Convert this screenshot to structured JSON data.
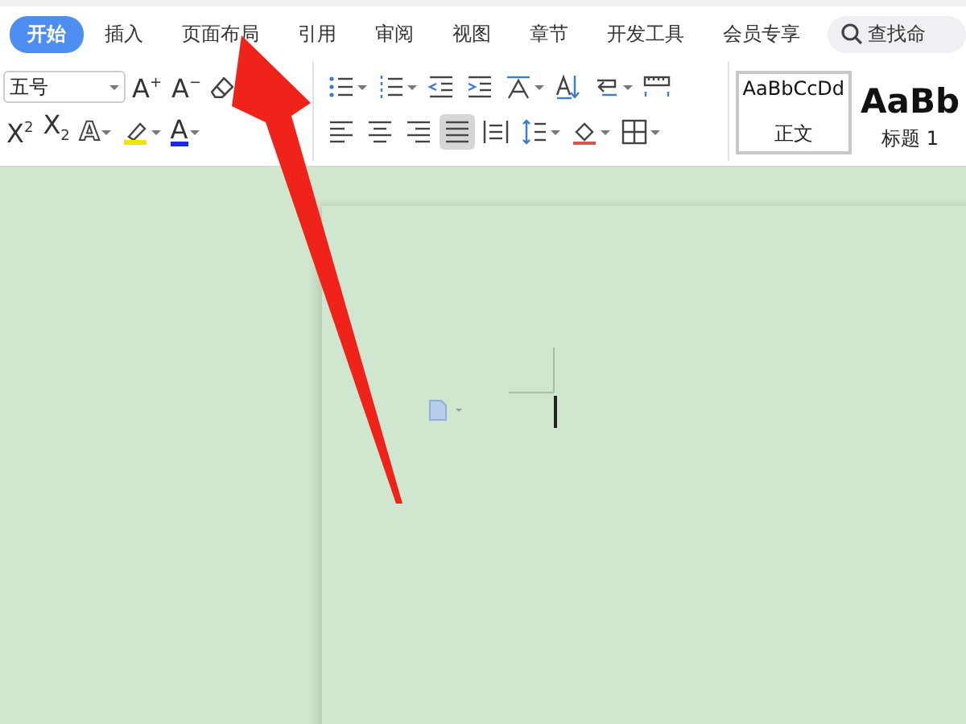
{
  "tabs": [
    {
      "label": "开始",
      "selected": true
    },
    {
      "label": "插入",
      "selected": false
    },
    {
      "label": "页面布局",
      "selected": false
    },
    {
      "label": "引用",
      "selected": false
    },
    {
      "label": "审阅",
      "selected": false
    },
    {
      "label": "视图",
      "selected": false
    },
    {
      "label": "章节",
      "selected": false
    },
    {
      "label": "开发工具",
      "selected": false
    },
    {
      "label": "会员专享",
      "selected": false
    }
  ],
  "search": {
    "placeholder": "查找命"
  },
  "font_size": {
    "value": "五号"
  },
  "font_row_1": [
    {
      "kind": "glyph",
      "text": "A$^{+}$",
      "dropdown": false
    },
    {
      "kind": "glyph",
      "text": "A$^{−}$",
      "dropdown": false
    },
    {
      "kind": "eraser",
      "dropdown": false
    }
  ],
  "font_row_2": [
    {
      "kind": "glyph",
      "text": "X$^{2}$",
      "dropdown": false
    },
    {
      "kind": "glyph",
      "text": "X$_{2}$",
      "dropdown": false
    },
    {
      "kind": "outline-glyph",
      "text": "A",
      "dropdown": true
    },
    {
      "kind": "highlighter",
      "dropdown": true
    },
    {
      "kind": "font-color",
      "text": "A",
      "dropdown": true
    }
  ],
  "para_row_1": [
    {
      "kind": "bullets",
      "dropdown": true
    },
    {
      "kind": "numbering",
      "dropdown": true
    },
    {
      "kind": "outdent",
      "dropdown": false
    },
    {
      "kind": "indent",
      "dropdown": false
    },
    {
      "kind": "asian-layout",
      "dropdown": true
    },
    {
      "kind": "sort",
      "dropdown": false
    },
    {
      "kind": "line-break",
      "dropdown": true
    },
    {
      "kind": "ruler",
      "dropdown": false
    }
  ],
  "para_row_2": [
    {
      "kind": "align-left",
      "selected": false
    },
    {
      "kind": "align-center",
      "selected": false
    },
    {
      "kind": "align-right",
      "selected": false
    },
    {
      "kind": "justify",
      "selected": true
    },
    {
      "kind": "distributed",
      "selected": false
    },
    {
      "kind": "line-spacing",
      "dropdown": true
    },
    {
      "kind": "shading",
      "dropdown": true
    },
    {
      "kind": "borders",
      "dropdown": true
    }
  ],
  "styles": [
    {
      "preview": "AaBbCcDd",
      "name": "正文",
      "selected": true
    },
    {
      "preview": "AaBb",
      "name": "标题 1",
      "selected": false
    }
  ]
}
